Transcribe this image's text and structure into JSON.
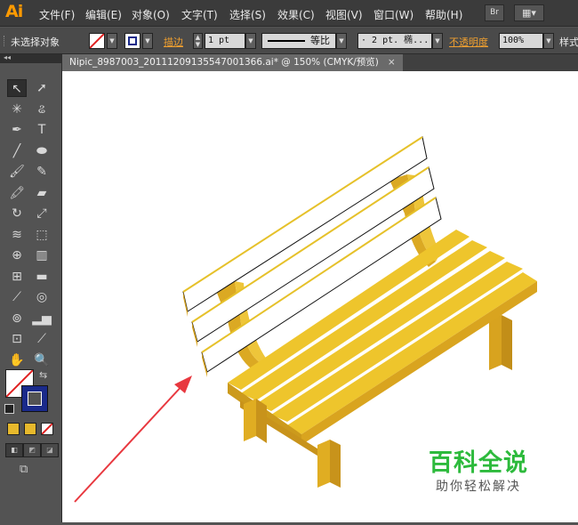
{
  "app": {
    "logo": "Ai"
  },
  "menu": [
    "文件(F)",
    "编辑(E)",
    "对象(O)",
    "文字(T)",
    "选择(S)",
    "效果(C)",
    "视图(V)",
    "窗口(W)",
    "帮助(H)"
  ],
  "menubar_buttons": {
    "bridge": "Br",
    "arrange": "▦▾"
  },
  "control": {
    "selection_label": "未选择对象",
    "stroke_label": "描边",
    "stroke_weight": "1 pt",
    "stroke_profile": "等比",
    "brush": "· 2 pt. 椭...",
    "opacity_label": "不透明度",
    "opacity_value": "100%",
    "style_label": "样式"
  },
  "document_tab": {
    "title": "Nipic_8987003_20111209135547001366.ai* @ 150% (CMYK/预览)",
    "close": "×"
  },
  "tools": [
    {
      "name": "selection-tool",
      "glyph": "↖",
      "active": true
    },
    {
      "name": "direct-selection-tool",
      "glyph": "➚"
    },
    {
      "name": "magic-wand-tool",
      "glyph": "✳"
    },
    {
      "name": "lasso-tool",
      "glyph": "ଌ"
    },
    {
      "name": "pen-tool",
      "glyph": "✒"
    },
    {
      "name": "type-tool",
      "glyph": "T"
    },
    {
      "name": "line-tool",
      "glyph": "╱"
    },
    {
      "name": "ellipse-tool",
      "glyph": "⬬"
    },
    {
      "name": "paintbrush-tool",
      "glyph": "🖌"
    },
    {
      "name": "pencil-tool",
      "glyph": "✎"
    },
    {
      "name": "blob-brush-tool",
      "glyph": "🖍"
    },
    {
      "name": "eraser-tool",
      "glyph": "▰"
    },
    {
      "name": "rotate-tool",
      "glyph": "↻"
    },
    {
      "name": "scale-tool",
      "glyph": "⤢"
    },
    {
      "name": "warp-tool",
      "glyph": "≋"
    },
    {
      "name": "free-transform-tool",
      "glyph": "⬚"
    },
    {
      "name": "shape-builder-tool",
      "glyph": "⊕"
    },
    {
      "name": "graph-tool",
      "glyph": "▥"
    },
    {
      "name": "mesh-tool",
      "glyph": "⊞"
    },
    {
      "name": "gradient-tool",
      "glyph": "▬"
    },
    {
      "name": "eyedropper-tool",
      "glyph": "⟋"
    },
    {
      "name": "blend-tool",
      "glyph": "◎"
    },
    {
      "name": "symbol-sprayer-tool",
      "glyph": "⊚"
    },
    {
      "name": "column-graph-tool",
      "glyph": "▂▅"
    },
    {
      "name": "artboard-tool",
      "glyph": "⊡"
    },
    {
      "name": "slice-tool",
      "glyph": "⟋"
    },
    {
      "name": "hand-tool",
      "glyph": "✋"
    },
    {
      "name": "zoom-tool",
      "glyph": "🔍"
    }
  ],
  "colors": {
    "bench_top": "#eec52c",
    "bench_front": "#d9a41f",
    "bench_side": "#c8931b",
    "leg": "#e0ad22",
    "arrow": "#e8383f",
    "watermark_green": "#2dba3c"
  },
  "watermark": {
    "title": "百科全说",
    "subtitle": "助你轻松解决"
  }
}
